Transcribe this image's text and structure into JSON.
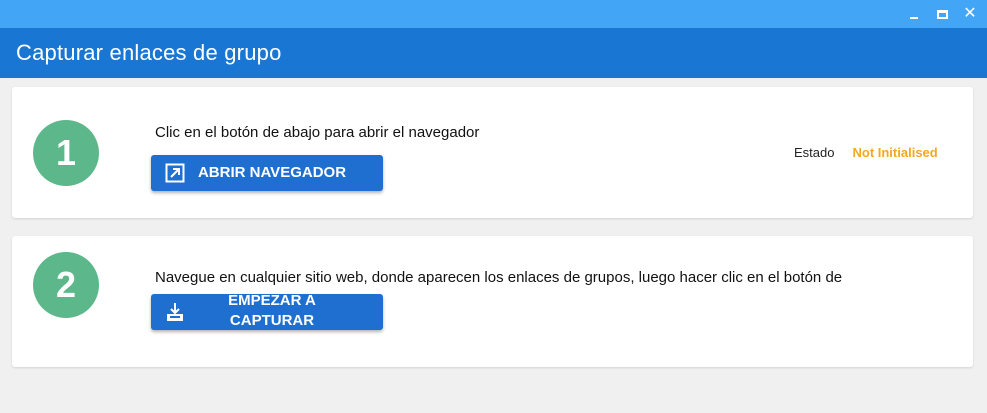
{
  "window": {
    "title": "Capturar enlaces de grupo",
    "controls": {
      "minimize": "_",
      "maximize": "□",
      "close": "✕"
    }
  },
  "steps": [
    {
      "number": "1",
      "instruction": "Clic en el botón de abajo para abrir el navegador",
      "button_label": "ABRIR NAVEGADOR",
      "button_icon": "open-external-icon",
      "status_label": "Estado",
      "status_value": "Not Initialised"
    },
    {
      "number": "2",
      "instruction": "Navegue en cualquier sitio web, donde aparecen los enlaces de grupos, luego hacer clic en el botón de",
      "button_label": "EMPEZAR A CAPTURAR",
      "button_icon": "download-tray-icon"
    }
  ],
  "colors": {
    "titlebar": "#42a5f5",
    "header": "#1976d2",
    "button": "#1e6fd0",
    "step_circle": "#5cb88a",
    "status_value": "#f5a623"
  }
}
